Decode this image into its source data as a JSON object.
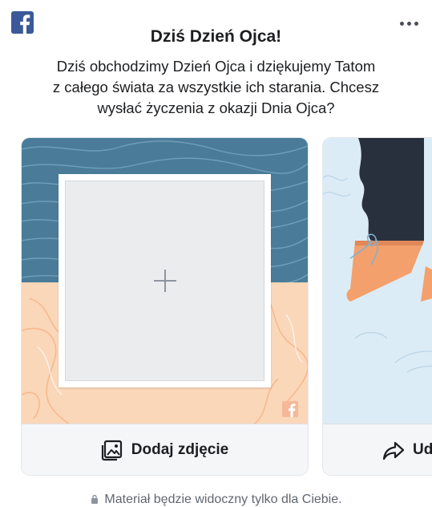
{
  "header": {
    "brand_icon": "facebook-logo-icon",
    "more_icon": "more-dots-icon",
    "title": "Dziś Dzień Ojca!",
    "description_lines": [
      "Dziś obchodzimy Dzień Ojca i dziękujemy Tatom",
      "z całego świata za wszystkie ich starania. Chcesz",
      "wysłać życzenia z okazji Dnia Ojca?"
    ]
  },
  "cards": [
    {
      "action_label": "Dodaj zdjęcie",
      "action_icon": "add-photo-icon",
      "slot_icon": "plus-icon",
      "colors": {
        "top": "#4a7c9a",
        "bottom": "#fbd7b9",
        "frame": "#ffffff",
        "slot": "#ebecee"
      }
    },
    {
      "action_label": "Ud",
      "action_icon": "share-arrow-icon",
      "colors": {
        "background": "#dcecf6",
        "dark": "#29303d",
        "accent": "#f3a06d"
      }
    }
  ],
  "footer": {
    "note": "Materiał będzie widoczny tylko dla Ciebie."
  }
}
